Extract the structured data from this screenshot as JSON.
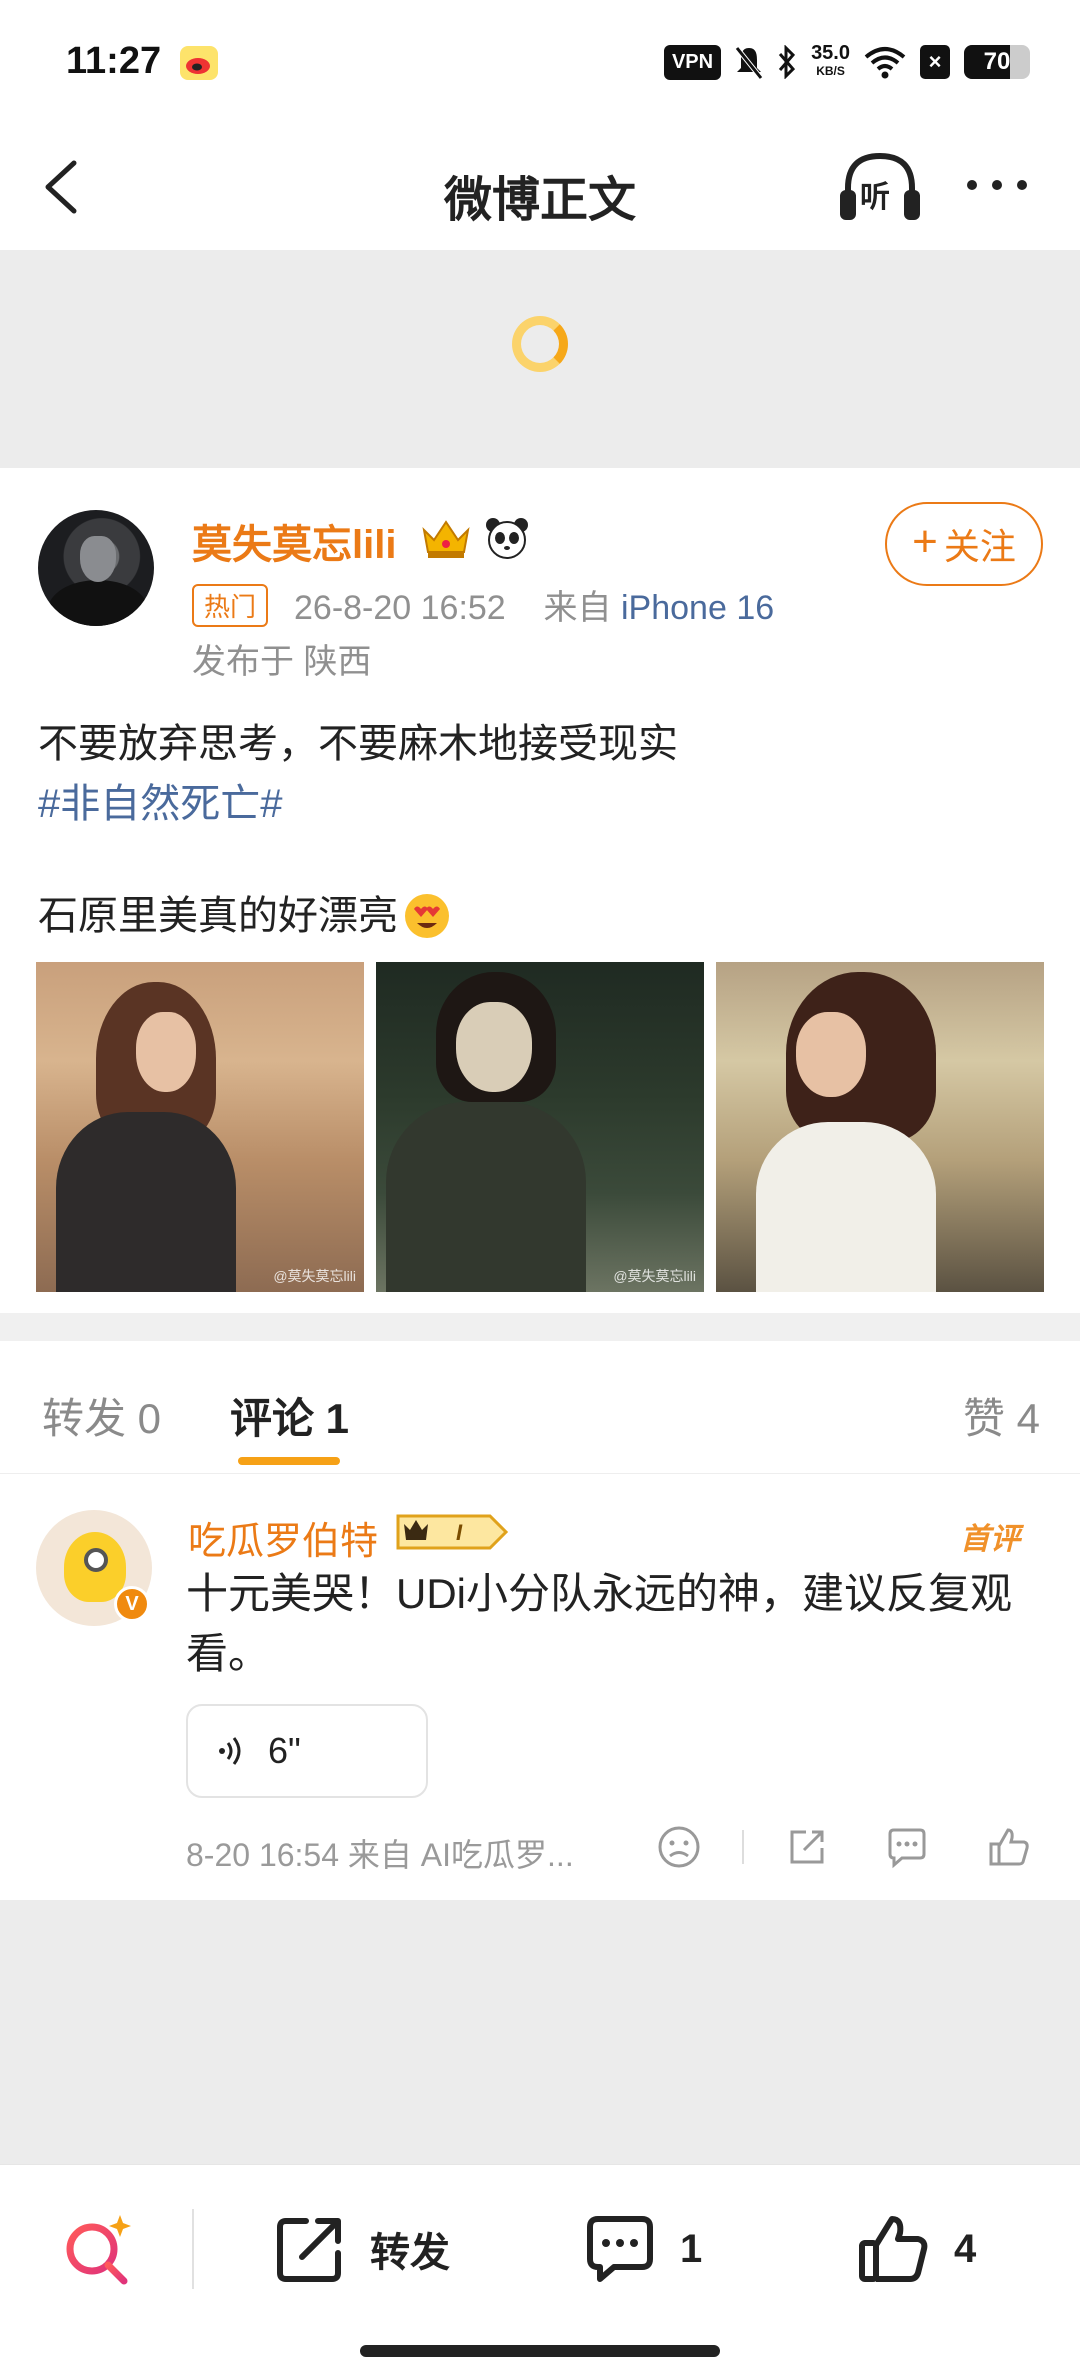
{
  "status_bar": {
    "time": "11:27",
    "vpn": "VPN",
    "speed_value": "35.0",
    "speed_unit": "KB/S",
    "battery": "70",
    "battery_level": 0.7
  },
  "nav": {
    "title": "微博正文",
    "listen_label": "听"
  },
  "post": {
    "username": "莫失莫忘lili",
    "follow_label": "关注",
    "hot_tag": "热门",
    "date": "26-8-20 16:52",
    "source_prefix": "来自",
    "device": "iPhone 16",
    "location": "发布于 陕西",
    "text_line1": "不要放弃思考，不要麻木地接受现实",
    "topic": "#非自然死亡#",
    "text_line2": "石原里美真的好漂亮",
    "photo_watermarks": [
      "@莫失莫忘lili",
      "@莫失莫忘lili",
      ""
    ]
  },
  "tabs": {
    "repost": "转发 0",
    "comment": "评论 1",
    "like": "赞 4"
  },
  "comment": {
    "username": "吃瓜罗伯特",
    "first_badge": "首评",
    "text": "十元美哭！UDi小分队永远的神，建议反复观看。",
    "voice_duration": "6\"",
    "meta": "8-20 16:54  来自 AI吃瓜罗..."
  },
  "bottom_bar": {
    "repost_label": "转发",
    "comment_count": "1",
    "like_count": "4"
  },
  "colors": {
    "accent_orange": "#eb7a16",
    "link_blue": "#4a6a9c",
    "tab_underline": "#f6a116"
  },
  "icons": [
    "back-icon",
    "headphones-icon",
    "more-icon",
    "crown-icon",
    "panda-icon",
    "voice-icon",
    "sad-face-icon",
    "share-icon",
    "reply-icon",
    "thumb-up-icon",
    "search-icon",
    "repost-icon",
    "comment-icon"
  ]
}
